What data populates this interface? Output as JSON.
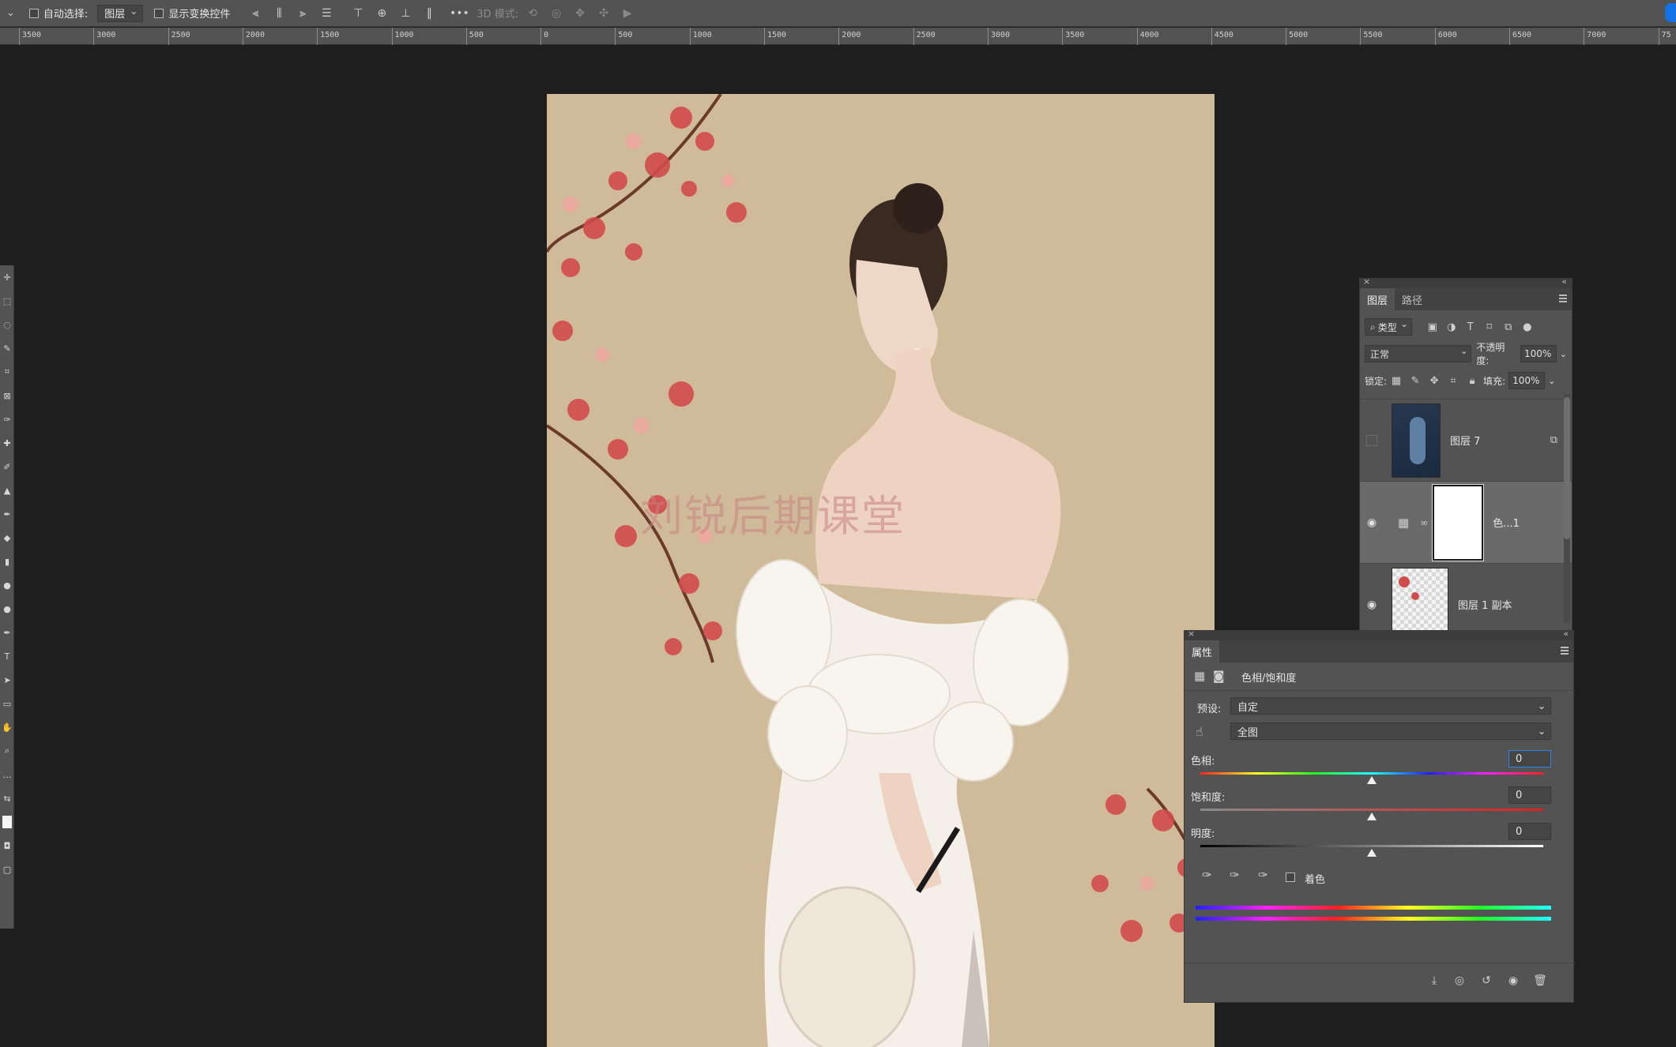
{
  "optbar": {
    "auto_select_label": "自动选择:",
    "auto_select_value": "图层",
    "show_transform_label": "显示变换控件",
    "more_glyph": "•••",
    "mode_3d_label": "3D 模式:"
  },
  "ruler": {
    "ticks": [
      "3500",
      "3000",
      "2500",
      "2000",
      "1500",
      "1000",
      "500",
      "0",
      "500",
      "1000",
      "1500",
      "2000",
      "2500",
      "3000",
      "3500",
      "4000",
      "4500",
      "5000",
      "5500",
      "6000",
      "6500",
      "7000",
      "75"
    ]
  },
  "canvas": {
    "watermark": "刘锐后期课堂",
    "background": "#cfbb9a"
  },
  "layers_panel": {
    "tabs": [
      "图层",
      "路径"
    ],
    "filter_label": "类型",
    "blend_mode": "正常",
    "opacity_label": "不透明度:",
    "opacity_value": "100%",
    "lock_label": "锁定:",
    "fill_label": "填充:",
    "fill_value": "100%",
    "layers": [
      {
        "name": "图层 7",
        "visible": false
      },
      {
        "name": "色...1",
        "visible": true,
        "selected": true
      },
      {
        "name": "图层 1 副本",
        "visible": true
      }
    ]
  },
  "properties_panel": {
    "tab": "属性",
    "title": "色相/饱和度",
    "preset_label": "预设:",
    "preset_value": "自定",
    "channel_value": "全图",
    "hue_label": "色相:",
    "hue_value": "0",
    "saturation_label": "饱和度:",
    "saturation_value": "0",
    "lightness_label": "明度:",
    "lightness_value": "0",
    "colorize_label": "着色"
  },
  "colors": {
    "accent": "#1473e6",
    "panel": "#535353",
    "workspace": "#1e1e1e"
  }
}
